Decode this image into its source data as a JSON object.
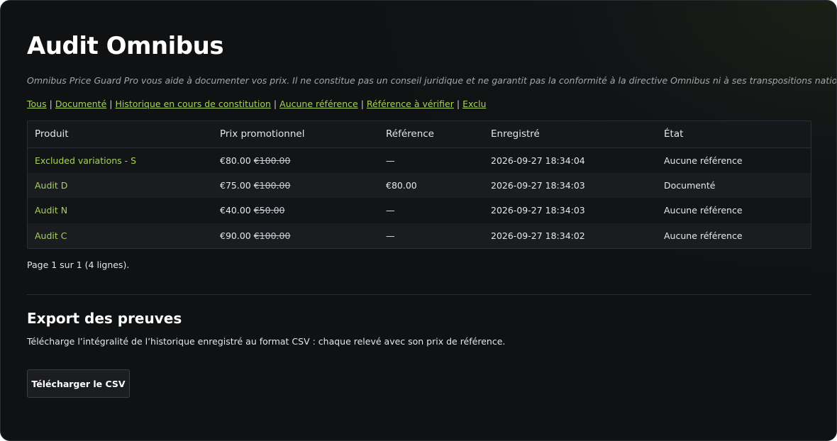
{
  "page": {
    "title": "Audit Omnibus",
    "disclaimer": "Omnibus Price Guard Pro vous aide à documenter vos prix. Il ne constitue pas un conseil juridique et ne garantit pas la conformité à la directive Omnibus ni à ses transpositions nationales."
  },
  "filters": [
    {
      "label": "Tous"
    },
    {
      "label": "Documenté"
    },
    {
      "label": "Historique en cours de constitution"
    },
    {
      "label": "Aucune référence"
    },
    {
      "label": "Référence à vérifier"
    },
    {
      "label": "Exclu"
    }
  ],
  "table": {
    "headers": {
      "product": "Produit",
      "promo_price": "Prix promotionnel",
      "reference": "Référence",
      "recorded": "Enregistré",
      "state": "État"
    },
    "rows": [
      {
        "product": "Excluded variations - S",
        "price": "€80.00",
        "old_price": "€100.00",
        "reference": "—",
        "recorded": "2026-09-27 18:34:04",
        "state": "Aucune référence"
      },
      {
        "product": "Audit D",
        "price": "€75.00",
        "old_price": "€100.00",
        "reference": "€80.00",
        "recorded": "2026-09-27 18:34:03",
        "state": "Documenté"
      },
      {
        "product": "Audit N",
        "price": "€40.00",
        "old_price": "€50.00",
        "reference": "—",
        "recorded": "2026-09-27 18:34:03",
        "state": "Aucune référence"
      },
      {
        "product": "Audit C",
        "price": "€90.00",
        "old_price": "€100.00",
        "reference": "—",
        "recorded": "2026-09-27 18:34:02",
        "state": "Aucune référence"
      }
    ]
  },
  "pagination": {
    "text": "Page 1 sur 1 (4 lignes)."
  },
  "export": {
    "title": "Export des preuves",
    "description": "Télécharge l’intégralité de l’historique enregistré au format CSV : chaque relevé avec son prix de référence.",
    "button_label": "Télécharger le CSV"
  },
  "colors": {
    "accent": "#a6d25a",
    "background": "#111316"
  }
}
